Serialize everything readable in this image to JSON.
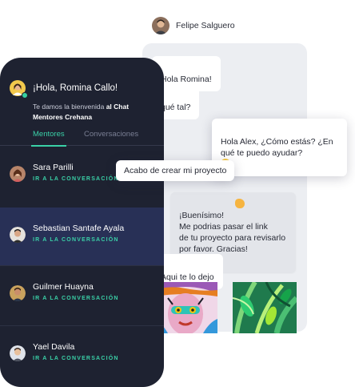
{
  "chat": {
    "contact_name": "Felipe Salguero",
    "messages": [
      {
        "text": "Hola Romina!"
      },
      {
        "text": "qué tal?"
      },
      {
        "text": "Hola Alex, ¿Cómo estás? ¿En\nqué te puedo ayudar?"
      },
      {
        "text": "Acabo de crear mi proyecto"
      },
      {
        "text": "¡Buenísimo!\nMe podrias pasar el link\nde tu proyecto para revisarlo\npor favor. Gracias!"
      },
      {
        "text": "Aqui te lo dejo"
      }
    ]
  },
  "mentors_panel": {
    "greeting": "¡Hola, Romina Callo!",
    "welcome_prefix": "Te damos la bienvenida",
    "welcome_bold": "al Chat Mentores Crehana",
    "tabs": [
      "Mentores",
      "Conversaciones"
    ],
    "action_label": "IR A LA CONVERSACIÓN",
    "mentors": [
      {
        "name": "Sara Parilli",
        "action": "IR A LA CONVERSACIÓN"
      },
      {
        "name": "Sebastian Santafe Ayala",
        "action": "IR A LA CONVERSACIÓN"
      },
      {
        "name": "Guilmer Huayna",
        "action": "IR A LA CONVERSACIÓN"
      },
      {
        "name": "Yael Davila",
        "action": "IR A LA CONVERSACIÓN"
      }
    ]
  },
  "colors": {
    "panel_dark": "#1e2231",
    "selected_row": "#283056",
    "accent_green": "#3ad0a7"
  }
}
